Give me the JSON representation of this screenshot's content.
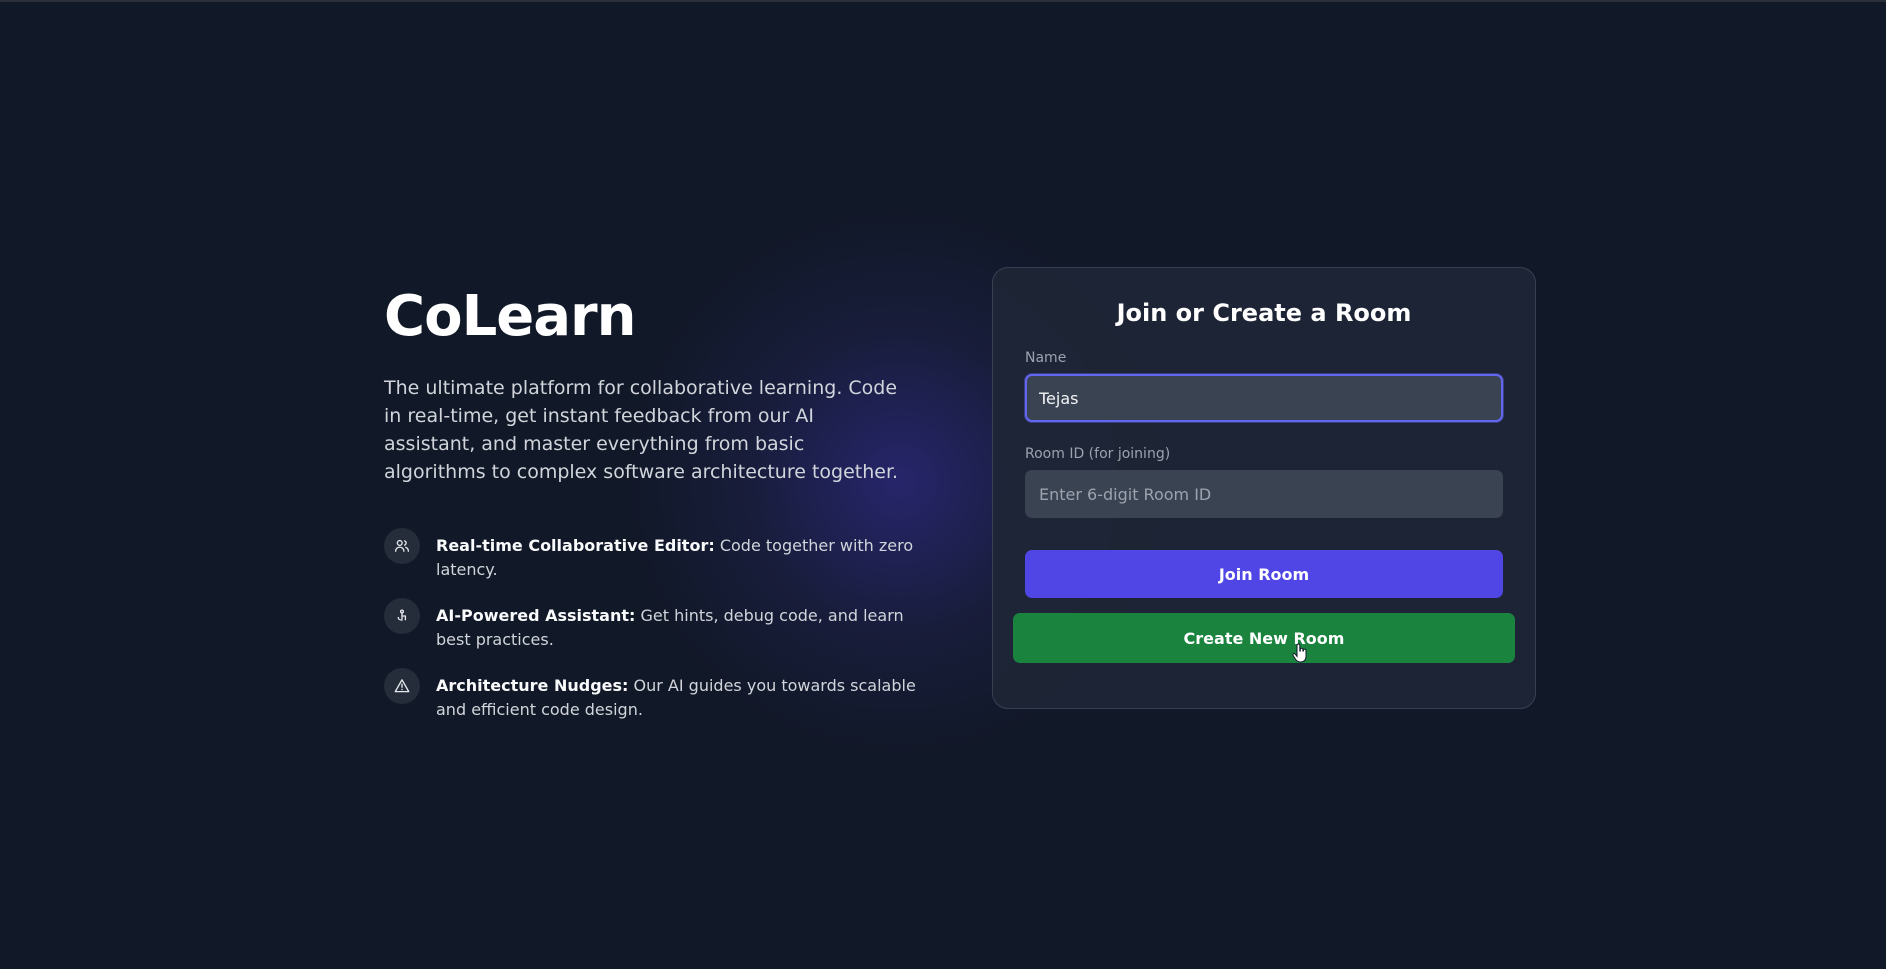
{
  "brand": {
    "title": "CoLearn",
    "tagline": "The ultimate platform for collaborative learning. Code in real-time, get instant feedback from our AI assistant, and master everything from basic algorithms to complex software architecture together."
  },
  "features": [
    {
      "icon": "users-icon",
      "title": "Real-time Collaborative Editor:",
      "description": "Code together with zero latency."
    },
    {
      "icon": "ai-assistant-icon",
      "title": "AI-Powered Assistant:",
      "description": "Get hints, debug code, and learn best practices."
    },
    {
      "icon": "warning-triangle-icon",
      "title": "Architecture Nudges:",
      "description": "Our AI guides you towards scalable and efficient code design."
    }
  ],
  "form": {
    "title": "Join or Create a Room",
    "name_label": "Name",
    "name_value": "Tejas",
    "room_label": "Room ID (for joining)",
    "room_value": "",
    "room_placeholder": "Enter 6-digit Room ID",
    "join_label": "Join Room",
    "create_label": "Create New Room"
  },
  "colors": {
    "background": "#111827",
    "card": "#1e2636",
    "accent": "#4f46e5",
    "create": "#1a843f",
    "focus": "#6366f1"
  }
}
